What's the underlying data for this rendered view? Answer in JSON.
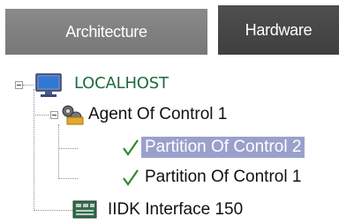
{
  "tabs": [
    {
      "label": "Architecture",
      "active": false
    },
    {
      "label": "Hardware",
      "active": true
    }
  ],
  "tree": {
    "root": {
      "label": "LOCALHOST",
      "icon": "computer-icon",
      "expanded": true
    },
    "agent": {
      "label": "Agent Of Control 1",
      "icon": "agent-icon",
      "expanded": true
    },
    "partition2": {
      "label": "Partition Of Control 2",
      "icon": "checkmark-icon",
      "selected": true
    },
    "partition1": {
      "label": "Partition Of Control 1",
      "icon": "checkmark-icon",
      "selected": false
    },
    "iidk": {
      "label": "IIDK Interface 150",
      "icon": "interface-board-icon"
    }
  },
  "colors": {
    "root_text": "#1d6b3c",
    "selection": "#9aa0cc",
    "check": "#2e8b2e"
  }
}
